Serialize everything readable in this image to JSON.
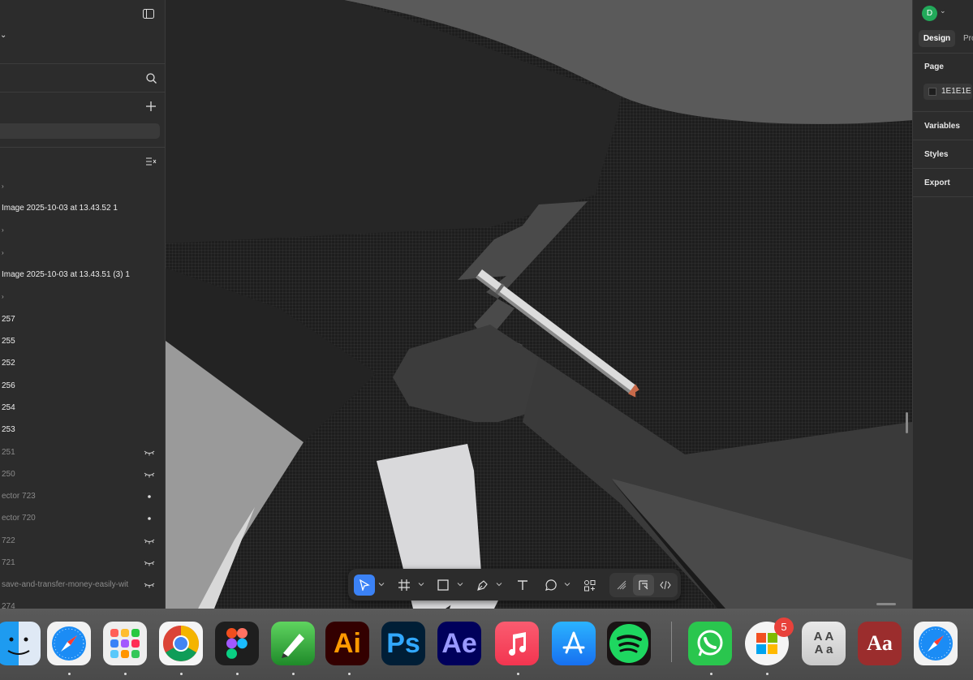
{
  "layers_panel": {
    "layers": [
      {
        "label": "Image 2025-10-03 at 13.43.52 1",
        "dim": false,
        "icon": ""
      },
      {
        "label": "Image 2025-10-03 at 13.43.51 (3) 1",
        "dim": false,
        "icon": ""
      },
      {
        "label": "257",
        "dim": false,
        "icon": ""
      },
      {
        "label": "255",
        "dim": false,
        "icon": ""
      },
      {
        "label": "252",
        "dim": false,
        "icon": ""
      },
      {
        "label": "256",
        "dim": false,
        "icon": ""
      },
      {
        "label": "254",
        "dim": false,
        "icon": ""
      },
      {
        "label": "253",
        "dim": false,
        "icon": ""
      },
      {
        "label": "251",
        "dim": true,
        "icon": "hidden-eye-icon"
      },
      {
        "label": "250",
        "dim": true,
        "icon": "hidden-eye-icon"
      },
      {
        "label": "ector 723",
        "dim": true,
        "icon": "dot-icon"
      },
      {
        "label": "ector 720",
        "dim": true,
        "icon": "dot-icon"
      },
      {
        "label": "722",
        "dim": true,
        "icon": "hidden-eye-icon"
      },
      {
        "label": "721",
        "dim": true,
        "icon": "hidden-eye-icon"
      },
      {
        "label": "save-and-transfer-money-easily-wit",
        "dim": true,
        "icon": "hidden-eye-icon"
      },
      {
        "label": "274",
        "dim": true,
        "icon": ""
      }
    ]
  },
  "right_panel": {
    "avatar_letter": "D",
    "tabs": [
      "Design",
      "Pro"
    ],
    "page_label": "Page",
    "page_color_value": "1E1E1E",
    "page_color_swatch": "#1e1e1e",
    "sections": [
      "Variables",
      "Styles",
      "Export"
    ]
  },
  "toolbar": {
    "tools": [
      "move-tool",
      "frame-tool",
      "shape-tool",
      "pen-tool",
      "text-tool",
      "comment-tool",
      "actions-tool"
    ],
    "modes": [
      "draw-mode",
      "design-mode",
      "dev-mode"
    ]
  },
  "dock": {
    "apps": [
      {
        "name": "Finder",
        "text": ""
      },
      {
        "name": "Safari",
        "text": ""
      },
      {
        "name": "Launchpad",
        "text": ""
      },
      {
        "name": "Chrome",
        "text": ""
      },
      {
        "name": "Figma",
        "text": ""
      },
      {
        "name": "Draw",
        "text": ""
      },
      {
        "name": "Illustrator",
        "text": "Ai"
      },
      {
        "name": "Photoshop",
        "text": "Ps"
      },
      {
        "name": "After Effects",
        "text": "Ae"
      },
      {
        "name": "Music",
        "text": ""
      },
      {
        "name": "App Store",
        "text": ""
      },
      {
        "name": "Spotify",
        "text": ""
      },
      {
        "name": "WhatsApp",
        "text": ""
      },
      {
        "name": "Microsoft",
        "text": ""
      },
      {
        "name": "Font Book",
        "text": "A A\nA a"
      },
      {
        "name": "Dictionary",
        "text": "Aa"
      },
      {
        "name": "Safari 2",
        "text": ""
      }
    ],
    "badge_count": "5"
  }
}
